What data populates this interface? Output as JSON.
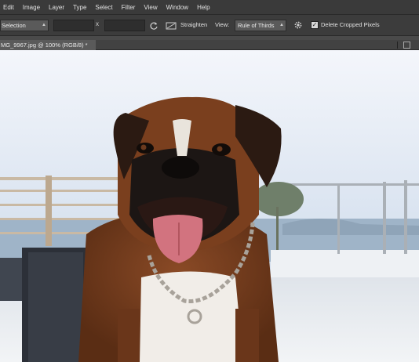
{
  "menubar": {
    "items": [
      {
        "label": "Edit"
      },
      {
        "label": "Image"
      },
      {
        "label": "Layer"
      },
      {
        "label": "Type"
      },
      {
        "label": "Select"
      },
      {
        "label": "Filter"
      },
      {
        "label": "View"
      },
      {
        "label": "Window"
      },
      {
        "label": "Help"
      }
    ]
  },
  "options": {
    "preset": "Selection",
    "width_value": "",
    "height_value": "",
    "x_sep": "x",
    "straighten_label": "Straighten",
    "view_label": "View:",
    "view_value": "Rule of Thirds",
    "delete_cropped_label": "Delete Cropped Pixels",
    "delete_cropped_checked": true
  },
  "document": {
    "tab_title": "MG_9967.jpg @ 100% (RGB/8) *"
  },
  "icons": {
    "swap": "swap-dimensions-icon",
    "straighten": "straighten-icon",
    "gear": "gear-icon",
    "dropdown": "chevron-down-icon"
  },
  "colors": {
    "menubar_bg": "#3a3a3a",
    "options_bg": "#3c3c3c",
    "tab_bg": "#5a5a5a"
  }
}
